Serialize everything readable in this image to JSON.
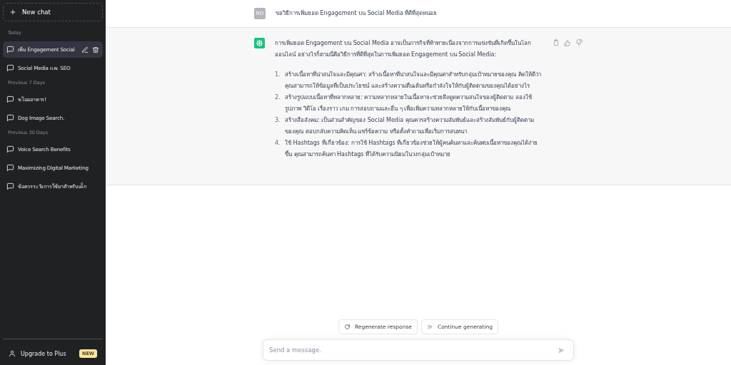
{
  "sidebar": {
    "new_chat": "New chat",
    "sections": [
      {
        "heading": "Today",
        "items": [
          {
            "title": "เพิ่ม Engagement Social",
            "selected": true
          },
          {
            "title": "Social Media และ SEO",
            "selected": false
          }
        ]
      },
      {
        "heading": "Previous 7 Days",
        "items": [
          {
            "title": "ขโมยอาหาร!",
            "selected": false
          },
          {
            "title": "Dog Image Search.",
            "selected": false
          }
        ]
      },
      {
        "heading": "Previous 30 Days",
        "items": [
          {
            "title": "Voice Search Benefits",
            "selected": false
          },
          {
            "title": "Maximizing Digital Marketing",
            "selected": false
          },
          {
            "title": "ข้อควรระวังการใช้ยาสำหรับเด็ก",
            "selected": false
          }
        ]
      }
    ],
    "upgrade": {
      "label": "Upgrade to Plus",
      "badge": "NEW"
    }
  },
  "conversation": [
    {
      "kind": "user",
      "avatar": "RO",
      "text": "ขอวิธีการเพิ่มยอด Engagement บน Social Media ที่ดีที่สุดหน่อย"
    },
    {
      "kind": "assistant",
      "text": "การเพิ่มยอด Engagement บน Social Media อาจเป็นภารกิจที่ท้าทายเนื่องจากการแข่งขันที่เกิดขึ้นในโลกออนไลน์ อย่างไรก็ตามนี่คือวิธีการที่ดีที่สุดในการเพิ่มยอด Engagement บน Social Media:",
      "list": [
        {
          "number": "1.",
          "text": "สร้างเนื้อหาที่น่าสนใจและมีคุณค่า: สร้างเนื้อหาที่น่าสนใจและมีคุณค่าสำหรับกลุ่มเป้าหมายของคุณ คิดให้ดีว่าคุณสามารถให้ข้อมูลที่เป็นประโยชน์ และสร้างความตื่นเต้นหรือกำลังใจให้กับผู้ติดตามของคุณได้อย่างไร"
        },
        {
          "number": "2.",
          "text": "สร้างรูปแบบเนื้อหาที่หลากหลาย: ความหลากหลายในเนื้อหาจะช่วยดึงดูดความสนใจของผู้ติดตาม ลองใช้รูปภาพ วิดีโอ เรื่องราว เกม การสอบถามและอื่น ๆ เพื่อเพิ่มความหลากหลายให้กับเนื้อหาของคุณ"
        },
        {
          "number": "3.",
          "text": "สร้างสื่อสังคม: เป็นส่วนสำคัญของ Social Media คุณควรสร้างความสัมพันธ์และสร้างสัมพันธ์กับผู้ติดตามของคุณ ตอบกลับความคิดเห็น แชร์ข้อความ หรือตั้งคำถามเพื่อเริ่มการสนทนา"
        },
        {
          "number": "4.",
          "text": "ใช้ Hashtags ที่เกี่ยวข้อง: การใช้ Hashtags ที่เกี่ยวข้องช่วยให้ผู้คนค้นหาและค้นพบเนื้อหาของคุณได้ง่ายขึ้น คุณสามารถค้นหา Hashtags ที่ได้รับความนิยมในวงกลุ่มเป้าหมาย"
        }
      ]
    }
  ],
  "actions": [
    "Regenerate response",
    "Continue generating"
  ],
  "composer": {
    "placeholder": "Send a message."
  }
}
